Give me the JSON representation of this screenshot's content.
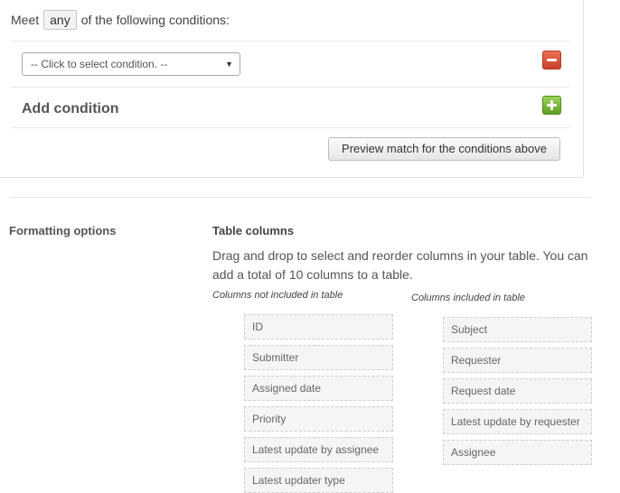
{
  "conditions": {
    "meet_prefix": "Meet",
    "meet_mode": "any",
    "meet_suffix": "of the following conditions:",
    "select_placeholder": "-- Click to select condition. --",
    "add_label": "Add condition",
    "preview_button": "Preview match for the conditions above"
  },
  "formatting": {
    "section_label": "Formatting options",
    "table_columns_title": "Table columns",
    "description": "Drag and drop to select and reorder columns in your table. You can add a total of 10 columns to a table.",
    "not_included_heading": "Columns not included in table",
    "included_heading": "Columns included in table",
    "not_included": [
      "ID",
      "Submitter",
      "Assigned date",
      "Priority",
      "Latest update by assignee",
      "Latest updater type"
    ],
    "included": [
      "Subject",
      "Requester",
      "Request date",
      "Latest update by requester",
      "Assignee"
    ]
  },
  "icons": {
    "remove": "minus-icon",
    "add": "plus-icon",
    "dropdown": "chevron-down-icon"
  },
  "colors": {
    "remove_button": "#d9533b",
    "add_button": "#7bbf3e"
  }
}
